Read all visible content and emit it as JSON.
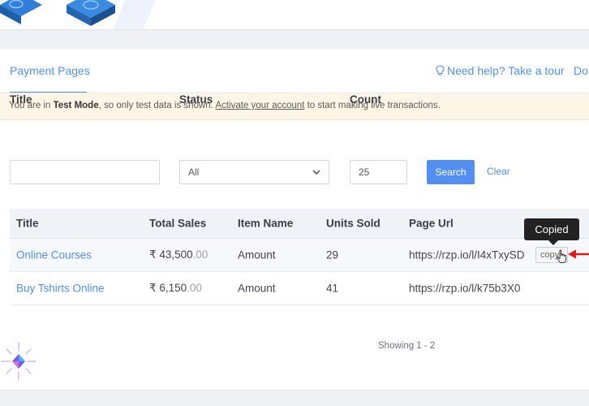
{
  "header": {
    "tab_label": "Payment Pages",
    "help_label": "Need help? Take a tour",
    "docs_label": "Do"
  },
  "banner": {
    "prefix": "You are in ",
    "mode": "Test Mode",
    "middle": ", so only test data is shown. ",
    "link": "Activate your account",
    "suffix": " to start making live transactions."
  },
  "filters": {
    "title_label": "Title",
    "title_value": "",
    "status_label": "Status",
    "status_value": "All",
    "count_label": "Count",
    "count_value": "25",
    "search_label": "Search",
    "clear_label": "Clear"
  },
  "table": {
    "headers": [
      "Title",
      "Total Sales",
      "Item Name",
      "Units Sold",
      "Page Url"
    ],
    "rows": [
      {
        "title": "Online Courses",
        "sales": "₹ 43,500",
        "paise": ".00",
        "item": "Amount",
        "units": "29",
        "url": "https://rzp.io/l/I4xTxySD",
        "copy": "copy"
      },
      {
        "title": "Buy Tshirts Online",
        "sales": "₹ 6,150",
        "paise": ".00",
        "item": "Amount",
        "units": "41",
        "url": "https://rzp.io/l/k75b3X0"
      }
    ]
  },
  "tooltip": "Copied",
  "pager": "Showing 1 - 2",
  "colors": {
    "accent": "#528ff0",
    "annotation_arrow": "#e0191f",
    "banner_bg": "#fdf6e7"
  }
}
